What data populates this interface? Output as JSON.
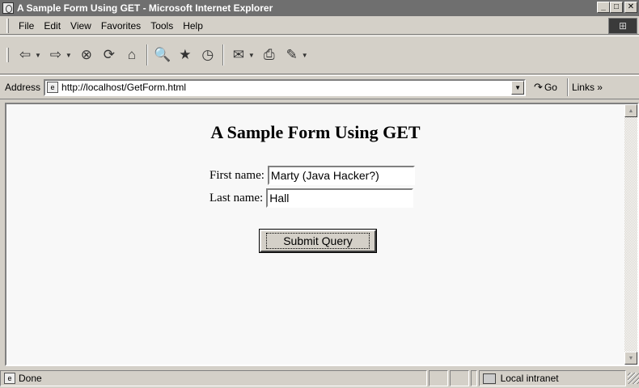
{
  "window": {
    "title": "A Sample Form Using GET - Microsoft Internet Explorer",
    "min_glyph": "_",
    "max_glyph": "□",
    "close_glyph": "✕"
  },
  "menu": {
    "items": [
      {
        "label": "File"
      },
      {
        "label": "Edit"
      },
      {
        "label": "View"
      },
      {
        "label": "Favorites"
      },
      {
        "label": "Tools"
      },
      {
        "label": "Help"
      }
    ]
  },
  "toolbar": {
    "back_icon": "⇦",
    "forward_icon": "⇨",
    "stop_icon": "⊗",
    "refresh_icon": "⟳",
    "home_icon": "⌂",
    "search_icon": "🔍",
    "favorites_icon": "★",
    "history_icon": "◷",
    "mail_icon": "✉",
    "print_icon": "⎙",
    "edit_icon": "✎",
    "dropdown": "▼"
  },
  "address": {
    "label": "Address",
    "url": "http://localhost/GetForm.html",
    "go_label": "Go",
    "links_label": "Links »"
  },
  "page": {
    "heading": "A Sample Form Using GET",
    "first_name_label": "First name:",
    "first_name_value": "Marty (Java Hacker?)",
    "last_name_label": "Last name:",
    "last_name_value": "Hall",
    "submit_label": "Submit Query"
  },
  "status": {
    "text": "Done",
    "zone": "Local intranet"
  }
}
